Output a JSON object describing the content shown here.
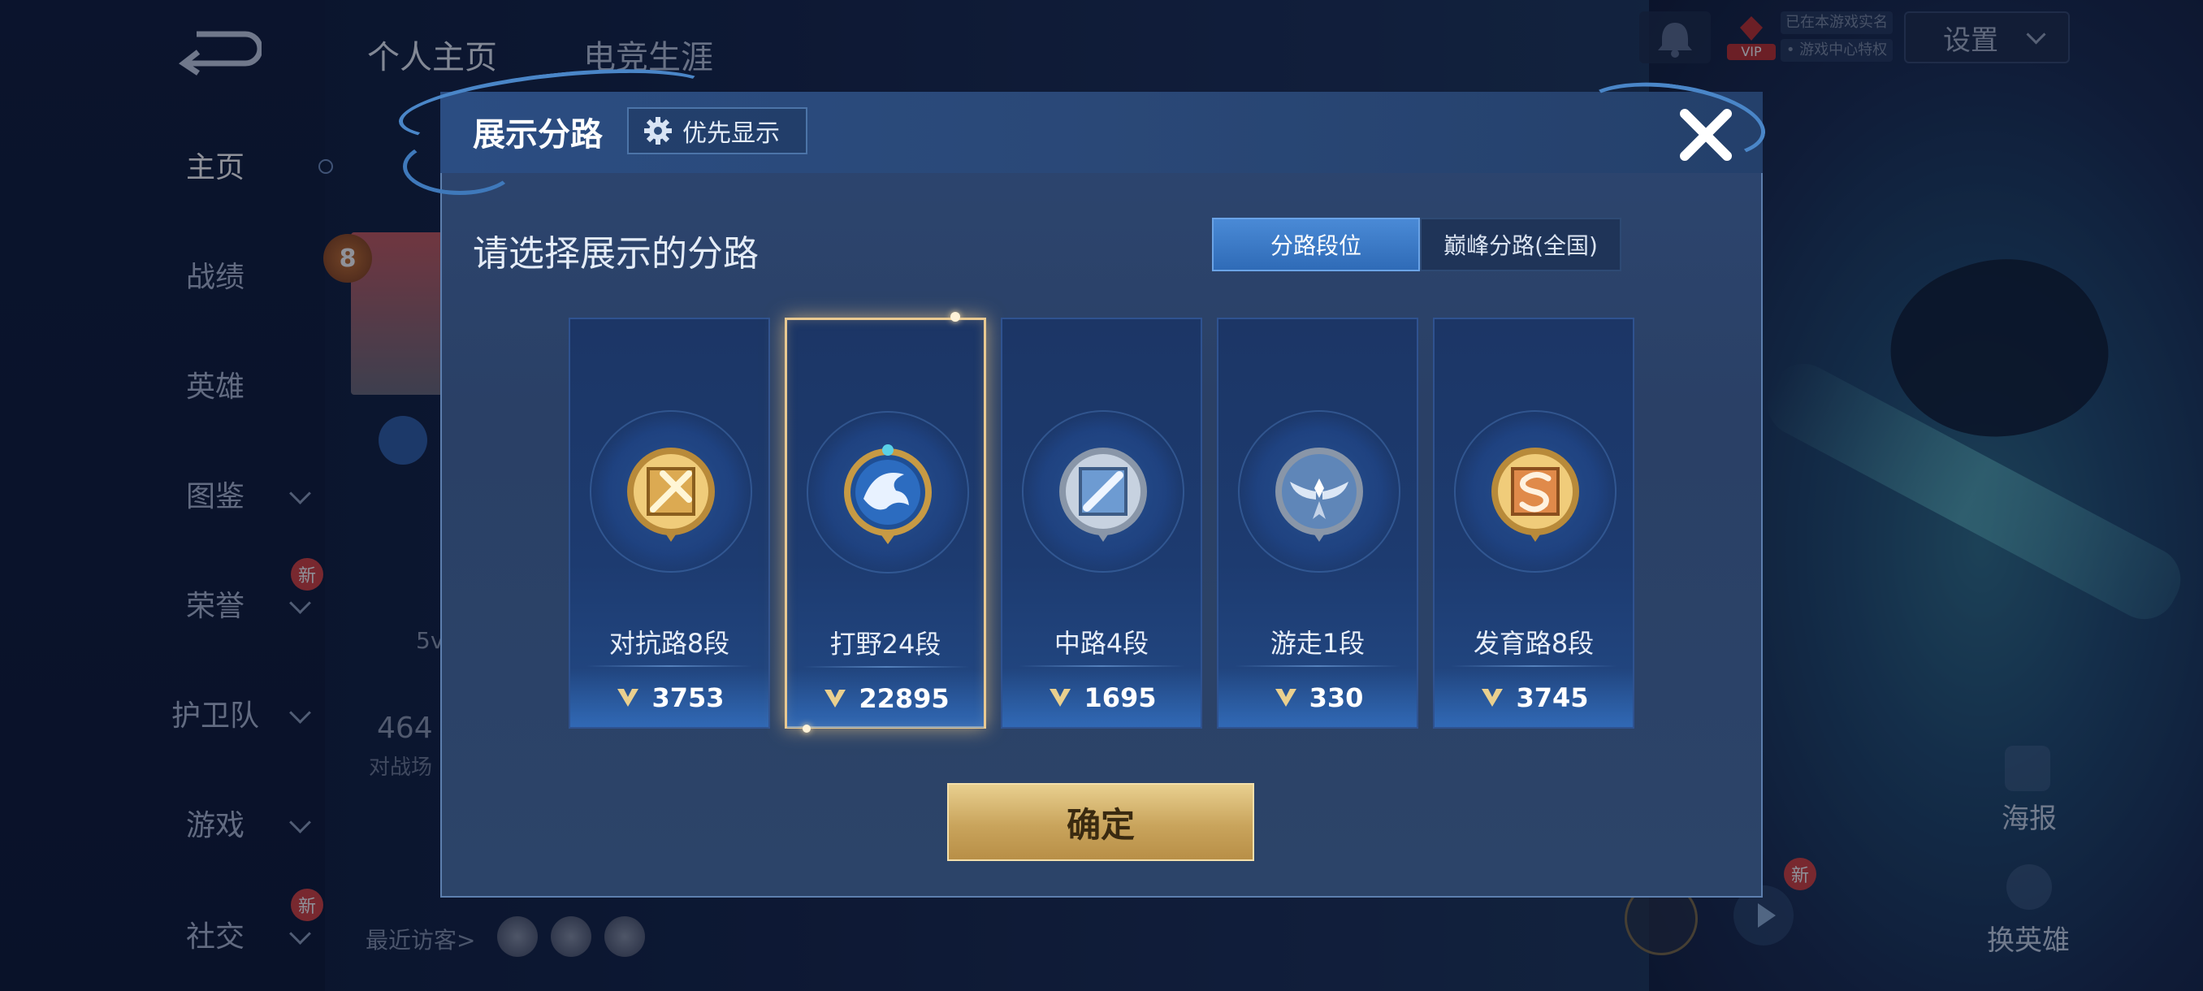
{
  "sidebar": {
    "items": [
      {
        "label": "主页",
        "active": true
      },
      {
        "label": "战绩"
      },
      {
        "label": "英雄"
      },
      {
        "label": "图鉴",
        "has_chevron": true
      },
      {
        "label": "荣誉",
        "has_chevron": true,
        "badge": "新"
      },
      {
        "label": "护卫队",
        "has_chevron": true
      },
      {
        "label": "游戏",
        "has_chevron": true
      },
      {
        "label": "社交",
        "has_chevron": true,
        "badge": "新"
      }
    ]
  },
  "top_tabs": [
    "个人主页",
    "电竞生涯"
  ],
  "top_right": {
    "settings_label": "设置",
    "vip_label": "VIP",
    "notice_line1": "已在本游戏实名",
    "notice_line2": "• 游戏中心特权"
  },
  "background_profile": {
    "level_badge": "8",
    "partial_text_1": "5v",
    "partial_number": "464",
    "partial_text_2": "对战场",
    "recent_visitors_label": "最近访客>"
  },
  "right_side": {
    "poster_label": "海报",
    "switch_hero_label": "换英雄",
    "new_badge": "新"
  },
  "dialog": {
    "title": "展示分路",
    "priority_button_label": "优先显示",
    "subtitle": "请选择展示的分路",
    "segment_tabs": [
      {
        "label": "分路段位",
        "active": true
      },
      {
        "label": "巅峰分路(全国)",
        "active": false
      }
    ],
    "cards": [
      {
        "name": "对抗路8段",
        "points": "3753",
        "emblem": "gold-crossed-swords-icon",
        "selected": false
      },
      {
        "name": "打野24段",
        "points": "22895",
        "emblem": "blue-dragon-icon",
        "selected": true
      },
      {
        "name": "中路4段",
        "points": "1695",
        "emblem": "silver-slash-icon",
        "selected": false
      },
      {
        "name": "游走1段",
        "points": "330",
        "emblem": "silver-wings-icon",
        "selected": false
      },
      {
        "name": "发育路8段",
        "points": "3745",
        "emblem": "gold-s-icon",
        "selected": false
      }
    ],
    "confirm_label": "确定"
  },
  "colors": {
    "accent_gold": "#e9c991",
    "segment_active": "#3f7fcf",
    "dialog_bg": "#2b4268"
  }
}
